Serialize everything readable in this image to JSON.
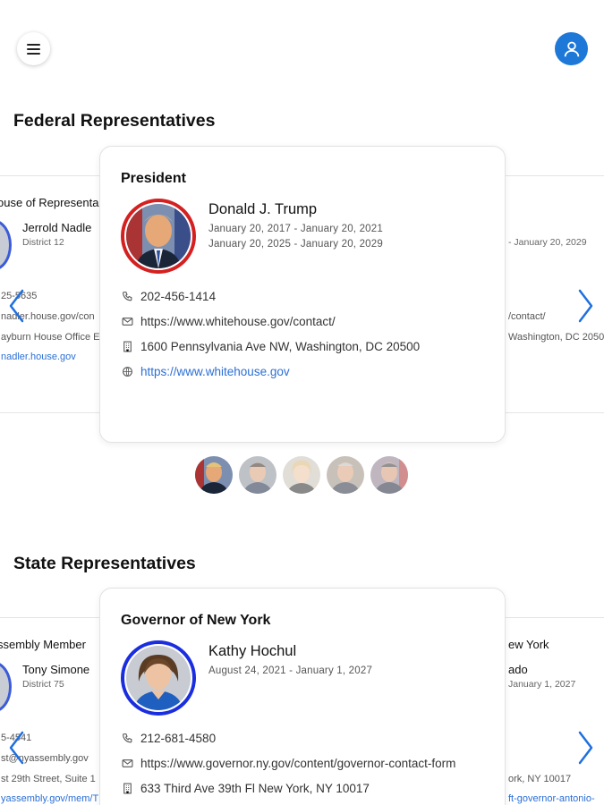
{
  "header": {
    "menu_icon": "hamburger-menu-icon",
    "account_icon": "user-account-icon",
    "accent_color": "#1e78d8"
  },
  "federal": {
    "title": "Federal Representatives",
    "left_card": {
      "office": "ouse of Representa",
      "name": "Jerrold Nadle",
      "district": "District 12",
      "phone": "25-5635",
      "contact": "nadler.house.gov/con",
      "address": "ayburn House Office E",
      "website": "nadler.house.gov"
    },
    "right_card": {
      "term": "- January 20, 2029",
      "contact": "/contact/",
      "address": "Washington, DC 2050"
    },
    "main_card": {
      "office": "President",
      "name": "Donald J. Trump",
      "terms": [
        "January 20, 2017 - January 20, 2021",
        "January 20, 2025 - January 20, 2029"
      ],
      "phone": "202-456-1414",
      "contact_url": "https://www.whitehouse.gov/contact/",
      "address": "1600 Pennsylvania Ave NW, Washington, DC 20500",
      "website": "https://www.whitehouse.gov",
      "ring_color": "#d42020"
    },
    "thumbnails": 5,
    "active_thumbnail": 1
  },
  "state": {
    "title": "State Representatives",
    "left_card": {
      "office": "ssembly Member",
      "name": "Tony Simone",
      "district": "District 75",
      "phone": "5-4541",
      "contact": "st@nyassembly.gov",
      "address": "st 29th Street, Suite 1",
      "website": "yassembly.gov/mem/T"
    },
    "right_card": {
      "office": "ew York",
      "name": "ado",
      "term": "January 1, 2027",
      "address": "ork, NY 10017",
      "website": "ft-governor-antonio-"
    },
    "main_card": {
      "office": "Governor of New York",
      "name": "Kathy Hochul",
      "terms": [
        "August 24, 2021 - January 1, 2027"
      ],
      "phone": "212-681-4580",
      "contact_url": "https://www.governor.ny.gov/content/governor-contact-form",
      "address": "633 Third Ave 39th Fl New York, NY 10017",
      "ring_color": "#1a2ee0"
    }
  },
  "icons": {
    "phone": "phone-icon",
    "mail": "mail-icon",
    "building": "building-icon",
    "globe": "globe-icon",
    "prev": "chevron-left-icon",
    "next": "chevron-right-icon"
  }
}
